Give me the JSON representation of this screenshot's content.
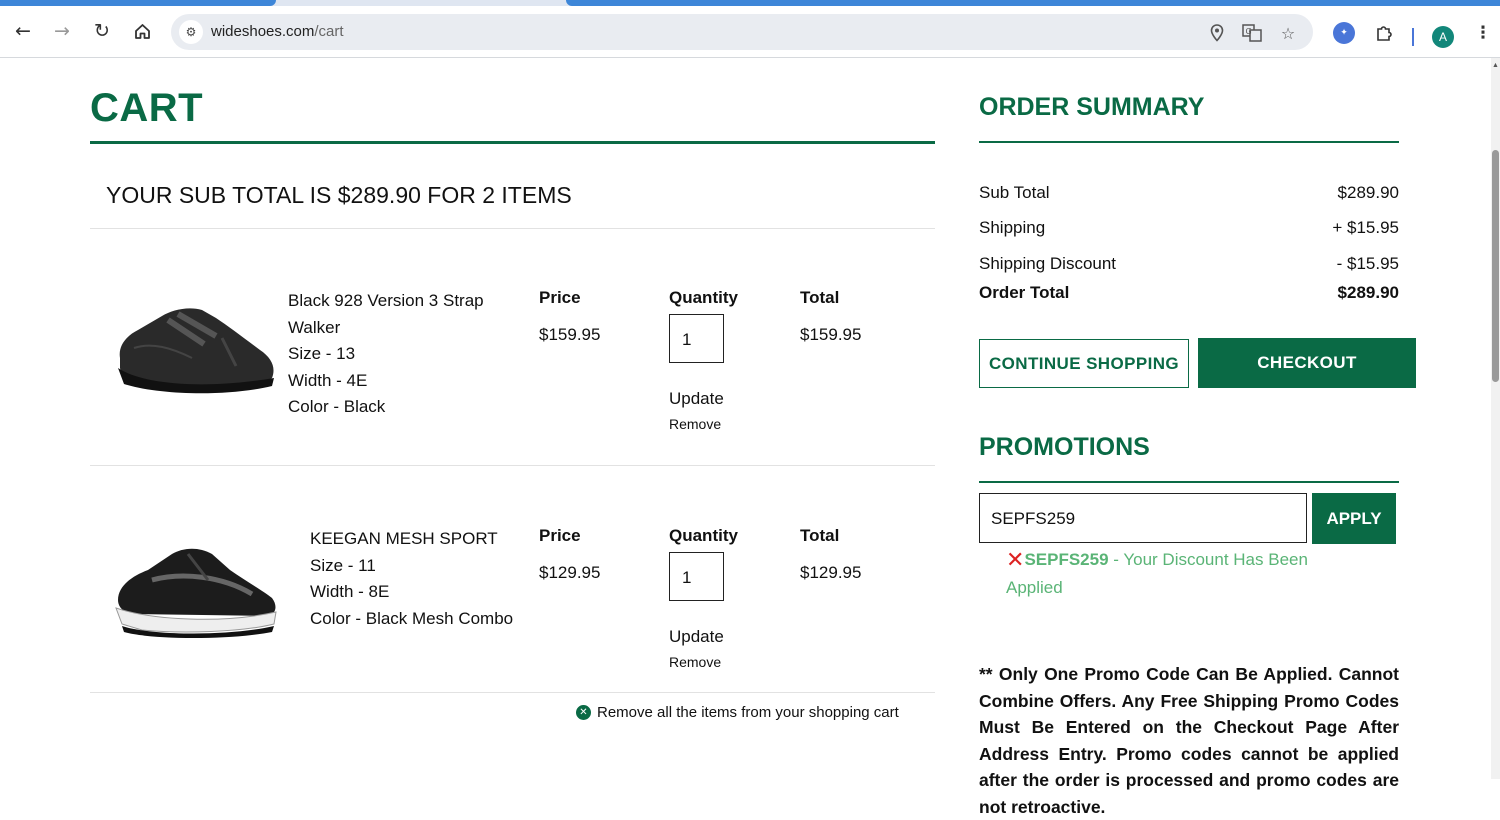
{
  "browser": {
    "url_domain": "wideshoes.com",
    "url_path": "/cart",
    "profile_initial": "A",
    "icons": [
      "back-arrow-icon",
      "forward-arrow-icon",
      "reload-icon",
      "home-icon",
      "site-info-icon",
      "location-icon",
      "translate-icon",
      "bookmark-star-icon",
      "extension-icon",
      "puzzle-icon",
      "menu-kebab-icon"
    ]
  },
  "cart": {
    "title": "CART",
    "subtotal_heading": "YOUR SUB TOTAL IS $289.90 FOR 2 ITEMS",
    "columns": {
      "price": "Price",
      "quantity": "Quantity",
      "total": "Total"
    },
    "items": [
      {
        "name_line1": "Black 928 Version 3 Strap",
        "name_line2": "Walker",
        "size": "Size - 13",
        "width": "Width - 4E",
        "color": "Color - Black",
        "price": "$159.95",
        "quantity": "1",
        "total": "$159.95",
        "update": "Update",
        "remove": "Remove"
      },
      {
        "name_line1": "KEEGAN MESH SPORT",
        "size": "Size - 11",
        "width": "Width - 8E",
        "color": "Color - Black Mesh Combo",
        "price": "$129.95",
        "quantity": "1",
        "total": "$129.95",
        "update": "Update",
        "remove": "Remove"
      }
    ],
    "remove_all": "Remove all the items from your shopping cart"
  },
  "summary": {
    "title": "ORDER SUMMARY",
    "rows": [
      {
        "label": "Sub Total",
        "value": "$289.90"
      },
      {
        "label": "Shipping",
        "value": "+ $15.95"
      },
      {
        "label": "Shipping Discount",
        "value": "- $15.95"
      },
      {
        "label": "Order Total",
        "value": "$289.90"
      }
    ],
    "continue_label": "CONTINUE SHOPPING",
    "checkout_label": "CHECKOUT"
  },
  "promotions": {
    "title": "PROMOTIONS",
    "code_value": "SEPFS259",
    "apply_label": "APPLY",
    "applied_code": "SEPFS259",
    "applied_message": " - Your Discount Has Been Applied",
    "note": "** Only One Promo Code Can Be Applied. Cannot Combine Offers. Any Free Shipping Promo Codes Must Be Entered on the Checkout Page After Address Entry. Promo codes cannot be applied after the order is processed and promo codes are not retroactive."
  },
  "colors": {
    "brand_green": "#0a6a45",
    "promo_green": "#5ab476",
    "error_red": "#dd2222"
  }
}
